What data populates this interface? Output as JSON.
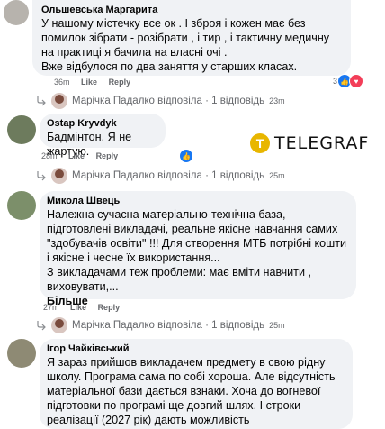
{
  "comments": [
    {
      "author": "Ольшевська Маргарита",
      "text": "У нашому містечку все ок . І зброя і кожен має без помилок зібрати - розібрати , і тир , і тактичну медичну на практиці я бачила на власні очі .\nВже відбулося по два заняття у старших класах.",
      "time": "36m",
      "like_label": "Like",
      "reply_label": "Reply",
      "reaction_count": "3"
    },
    {
      "author": "Ostap Kryvdyk",
      "text": "Бадмінтон. Я не жартую.",
      "time": "28m",
      "like_label": "Like",
      "reply_label": "Reply"
    },
    {
      "author": "Микола Швець",
      "text": "Належна сучасна матеріально-технічна база, підготовлені викладачі, реальне якісне навчання самих\n\"здобувачів освіти\" !!! Для створення МТБ потрібні кошти і якісне і чесне їх використання...\nЗ викладачами теж проблеми: має вміти навчити , виховувати,...",
      "see_more": "Більше",
      "time": "27m",
      "like_label": "Like",
      "reply_label": "Reply"
    },
    {
      "author": "Ігор Чайківський",
      "text": "Я зараз прийшов викладачем предмету в свою рідну школу. Програма сама по собі хороша. Але відсутність матеріальної бази дається взнаки. Хоча до вогневої підготовки по програмі ще довгий шлях. І строки реалізації (2027 рік) дають можливість"
    }
  ],
  "replies": [
    {
      "text": "Марічка Падалко відповіла · 1 відповідь",
      "time": "23m"
    },
    {
      "text": "Марічка Падалко відповіла · 1 відповідь",
      "time": "25m"
    },
    {
      "text": "Марічка Падалко відповіла · 1 відповідь",
      "time": "25m"
    }
  ],
  "watermark": {
    "glyph": "T",
    "word": "TELEGRAF"
  },
  "colors": {
    "bubble": "#f0f2f5",
    "like": "#1877f2",
    "heart": "#f33e58",
    "logo": "#e8b600"
  },
  "icons": [
    "avatar",
    "reply-arrow-icon",
    "like-reaction-icon",
    "love-reaction-icon"
  ]
}
